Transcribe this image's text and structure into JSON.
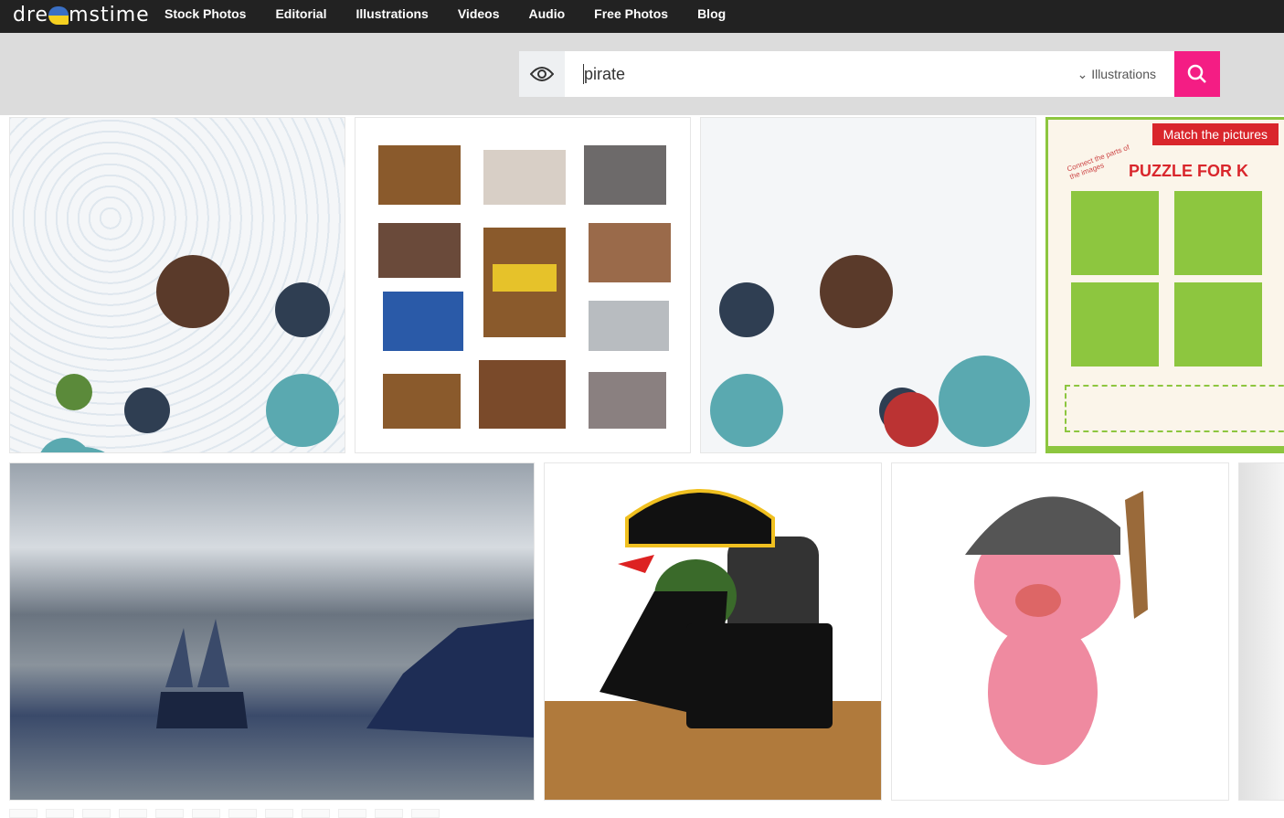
{
  "header": {
    "logo": "dreamstime",
    "nav": [
      "Stock Photos",
      "Editorial",
      "Illustrations",
      "Videos",
      "Audio",
      "Free Photos",
      "Blog"
    ]
  },
  "search": {
    "query": "pirate",
    "category": "Illustrations",
    "icons": [
      "eye-icon",
      "chevron-down-icon",
      "search-icon"
    ]
  },
  "results": [
    {
      "alt": "pirate doodle icon set"
    },
    {
      "alt": "treasure chests set"
    },
    {
      "alt": "pirate doodle icon set mirrored"
    },
    {
      "alt": "puzzle for kids",
      "banner": "Match the pictures",
      "subtitle": "Connect the parts of the images",
      "title": "PUZZLE FOR K"
    },
    {
      "alt": "pirate ship in stormy sea"
    },
    {
      "alt": "octopus pirate with laptop"
    },
    {
      "alt": "pig pirate with wooden sword"
    }
  ],
  "colors": {
    "accent": "#f41d84",
    "topbar": "#222222"
  }
}
